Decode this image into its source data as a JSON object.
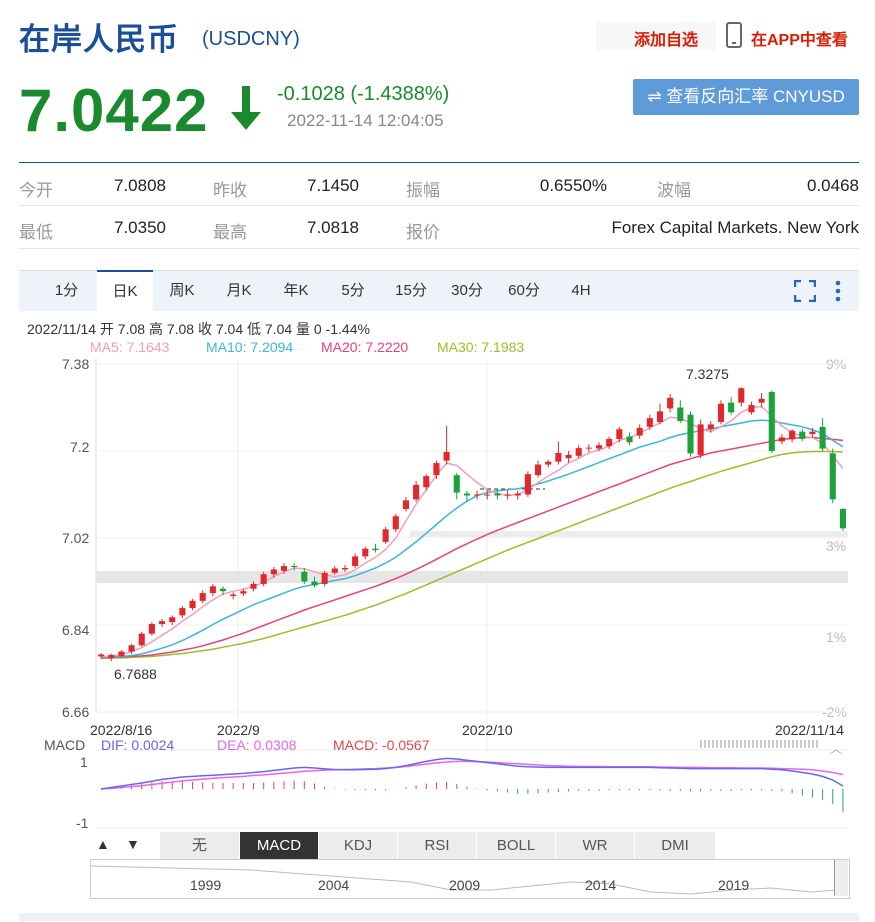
{
  "header": {
    "title": "在岸人民币",
    "code": "(USDCNY)",
    "add_watch": "添加自选",
    "view_app": "在APP中查看",
    "price": "7.0422",
    "change": "-0.1028 (-1.4388%)",
    "timestamp": "2022-11-14 12:04:05",
    "reverse_button": "⇌ 查看反向汇率 CNYUSD"
  },
  "stats": {
    "open_label": "今开",
    "open": "7.0808",
    "prev_close_label": "昨收",
    "prev_close": "7.1450",
    "amplitude_label": "振幅",
    "amplitude": "0.6550%",
    "wave_label": "波幅",
    "wave": "0.0468",
    "low_label": "最低",
    "low": "7.0350",
    "high_label": "最高",
    "high": "7.0818",
    "quote_label": "报价",
    "quote": "Forex Capital Markets. New York"
  },
  "period_tabs": [
    "1分",
    "日K",
    "周K",
    "月K",
    "年K",
    "5分",
    "15分",
    "30分",
    "60分",
    "4H"
  ],
  "active_period": "日K",
  "colors": {
    "up": "#e0292c",
    "down": "#1ca13b",
    "ma5": "#f0a0b8",
    "ma10": "#3cb5dc",
    "ma20": "#e8427a",
    "ma30": "#9bbf2a",
    "dif": "#6666ee",
    "dea": "#e666e6",
    "accent": "#1a4f95"
  },
  "chart_data": [
    {
      "type": "candlestick",
      "title": "",
      "info_line": "2022/11/14 开 7.08 高 7.08 收 7.04 低 7.04 量 0 -1.44%",
      "ma_legend": [
        {
          "name": "MA5",
          "text": "MA5: 7.1643"
        },
        {
          "name": "MA10",
          "text": "MA10: 7.2094"
        },
        {
          "name": "MA20",
          "text": "MA20: 7.2220"
        },
        {
          "name": "MA30",
          "text": "MA30: 7.1983"
        }
      ],
      "y_ticks": [
        "7.38",
        "7.2",
        "7.02",
        "6.84",
        "6.66"
      ],
      "y_tick_values": [
        7.38,
        7.2,
        7.02,
        6.84,
        6.66
      ],
      "right_ticks": [
        "9%",
        "3%",
        "1%",
        "-2%"
      ],
      "ylim": [
        6.66,
        7.38
      ],
      "x_ticks": [
        "2022/8/16",
        "2022/9",
        "2022/10",
        "2022/11/14"
      ],
      "max_label": "7.3275",
      "min_label": "6.7688",
      "candles": [
        [
          6.775,
          6.779,
          6.77,
          6.782
        ],
        [
          6.771,
          6.778,
          6.765,
          6.781
        ],
        [
          6.776,
          6.785,
          6.772,
          6.788
        ],
        [
          6.785,
          6.798,
          6.78,
          6.801
        ],
        [
          6.798,
          6.822,
          6.795,
          6.826
        ],
        [
          6.822,
          6.842,
          6.818,
          6.846
        ],
        [
          6.842,
          6.848,
          6.836,
          6.853
        ],
        [
          6.846,
          6.856,
          6.84,
          6.86
        ],
        [
          6.86,
          6.875,
          6.854,
          6.879
        ],
        [
          6.875,
          6.89,
          6.87,
          6.894
        ],
        [
          6.89,
          6.906,
          6.885,
          6.912
        ],
        [
          6.906,
          6.92,
          6.9,
          6.925
        ],
        [
          6.915,
          6.91,
          6.902,
          6.92
        ],
        [
          6.9,
          6.903,
          6.893,
          6.908
        ],
        [
          6.905,
          6.91,
          6.9,
          6.915
        ],
        [
          6.915,
          6.925,
          6.91,
          6.93
        ],
        [
          6.925,
          6.945,
          6.92,
          6.95
        ],
        [
          6.945,
          6.955,
          6.938,
          6.96
        ],
        [
          6.952,
          6.962,
          6.946,
          6.968
        ],
        [
          6.962,
          6.96,
          6.952,
          6.968
        ],
        [
          6.95,
          6.93,
          6.925,
          6.958
        ],
        [
          6.93,
          6.922,
          6.918,
          6.94
        ],
        [
          6.925,
          6.948,
          6.92,
          6.952
        ],
        [
          6.948,
          6.957,
          6.944,
          6.962
        ],
        [
          6.955,
          6.958,
          6.95,
          6.964
        ],
        [
          6.962,
          6.982,
          6.958,
          6.988
        ],
        [
          6.982,
          6.998,
          6.976,
          7.002
        ],
        [
          6.998,
          6.995,
          6.99,
          7.008
        ],
        [
          7.012,
          7.038,
          7.008,
          7.043
        ],
        [
          7.038,
          7.065,
          7.032,
          7.07
        ],
        [
          7.08,
          7.098,
          7.075,
          7.105
        ],
        [
          7.1,
          7.13,
          7.095,
          7.138
        ],
        [
          7.125,
          7.148,
          7.118,
          7.152
        ],
        [
          7.15,
          7.175,
          7.142,
          7.18
        ],
        [
          7.18,
          7.198,
          7.172,
          7.252
        ],
        [
          7.15,
          7.114,
          7.1,
          7.155
        ],
        [
          7.112,
          7.108,
          7.095,
          7.118
        ],
        [
          7.108,
          7.11,
          7.1,
          7.118
        ],
        [
          7.108,
          7.11,
          7.1,
          7.12
        ],
        [
          7.112,
          7.108,
          7.1,
          7.12
        ],
        [
          7.108,
          7.11,
          7.1,
          7.118
        ],
        [
          7.108,
          7.112,
          7.1,
          7.118
        ],
        [
          7.11,
          7.152,
          7.105,
          7.158
        ],
        [
          7.15,
          7.172,
          7.145,
          7.18
        ],
        [
          7.172,
          7.178,
          7.166,
          7.182
        ],
        [
          7.178,
          7.196,
          7.172,
          7.22
        ],
        [
          7.185,
          7.192,
          7.176,
          7.2
        ],
        [
          7.19,
          7.206,
          7.185,
          7.212
        ],
        [
          7.205,
          7.207,
          7.198,
          7.214
        ],
        [
          7.205,
          7.212,
          7.2,
          7.218
        ],
        [
          7.21,
          7.225,
          7.204,
          7.23
        ],
        [
          7.225,
          7.245,
          7.218,
          7.25
        ],
        [
          7.23,
          7.218,
          7.212,
          7.238
        ],
        [
          7.232,
          7.248,
          7.225,
          7.255
        ],
        [
          7.25,
          7.268,
          7.244,
          7.275
        ],
        [
          7.26,
          7.282,
          7.255,
          7.298
        ],
        [
          7.288,
          7.31,
          7.28,
          7.318
        ],
        [
          7.29,
          7.262,
          7.258,
          7.305
        ],
        [
          7.275,
          7.195,
          7.188,
          7.282
        ],
        [
          7.192,
          7.255,
          7.185,
          7.265
        ],
        [
          7.245,
          7.255,
          7.238,
          7.262
        ],
        [
          7.26,
          7.298,
          7.255,
          7.305
        ],
        [
          7.3,
          7.28,
          7.275,
          7.312
        ],
        [
          7.3,
          7.33,
          7.292,
          7.332
        ],
        [
          7.28,
          7.295,
          7.275,
          7.302
        ],
        [
          7.3,
          7.308,
          7.29,
          7.32
        ],
        [
          7.322,
          7.2,
          7.195,
          7.325
        ],
        [
          7.22,
          7.228,
          7.214,
          7.235
        ],
        [
          7.224,
          7.242,
          7.218,
          7.245
        ],
        [
          7.24,
          7.225,
          7.22,
          7.246
        ],
        [
          7.235,
          7.24,
          7.228,
          7.248
        ],
        [
          7.25,
          7.205,
          7.2,
          7.268
        ],
        [
          7.195,
          7.1,
          7.092,
          7.205
        ],
        [
          7.08,
          7.04,
          7.035,
          7.082
        ]
      ],
      "ma5": [
        6.774,
        6.776,
        6.779,
        6.785,
        6.793,
        6.805,
        6.819,
        6.832,
        6.848,
        6.862,
        6.878,
        6.892,
        6.904,
        6.91,
        6.914,
        6.92,
        6.928,
        6.94,
        6.95,
        6.958,
        6.956,
        6.95,
        6.944,
        6.94,
        6.944,
        6.954,
        6.968,
        6.98,
        6.996,
        7.02,
        7.055,
        7.09,
        7.12,
        7.15,
        7.175,
        7.17,
        7.152,
        7.135,
        7.12,
        7.112,
        7.108,
        7.11,
        7.12,
        7.135,
        7.148,
        7.16,
        7.175,
        7.185,
        7.196,
        7.202,
        7.21,
        7.222,
        7.228,
        7.236,
        7.248,
        7.258,
        7.27,
        7.268,
        7.258,
        7.245,
        7.24,
        7.25,
        7.262,
        7.28,
        7.29,
        7.292,
        7.272,
        7.252,
        7.238,
        7.23,
        7.228,
        7.216,
        7.19,
        7.164
      ],
      "ma10": [
        6.773,
        6.774,
        6.775,
        6.777,
        6.78,
        6.786,
        6.792,
        6.799,
        6.808,
        6.818,
        6.829,
        6.841,
        6.852,
        6.862,
        6.872,
        6.882,
        6.89,
        6.898,
        6.906,
        6.914,
        6.92,
        6.924,
        6.928,
        6.932,
        6.936,
        6.942,
        6.95,
        6.958,
        6.968,
        6.98,
        6.996,
        7.012,
        7.03,
        7.048,
        7.066,
        7.082,
        7.096,
        7.108,
        7.114,
        7.118,
        7.12,
        7.122,
        7.126,
        7.132,
        7.138,
        7.145,
        7.152,
        7.16,
        7.168,
        7.176,
        7.184,
        7.192,
        7.2,
        7.208,
        7.214,
        7.22,
        7.228,
        7.234,
        7.238,
        7.242,
        7.246,
        7.25,
        7.254,
        7.258,
        7.262,
        7.264,
        7.262,
        7.258,
        7.254,
        7.25,
        7.244,
        7.236,
        7.222,
        7.209
      ],
      "ma20": [
        6.772,
        6.773,
        6.774,
        6.775,
        6.776,
        6.778,
        6.781,
        6.784,
        6.788,
        6.792,
        6.797,
        6.803,
        6.809,
        6.816,
        6.823,
        6.831,
        6.839,
        6.847,
        6.855,
        6.863,
        6.871,
        6.878,
        6.885,
        6.892,
        6.899,
        6.906,
        6.913,
        6.92,
        6.928,
        6.936,
        6.945,
        6.955,
        6.965,
        6.976,
        6.987,
        6.998,
        7.008,
        7.018,
        7.027,
        7.036,
        7.044,
        7.052,
        7.06,
        7.068,
        7.076,
        7.084,
        7.092,
        7.1,
        7.108,
        7.116,
        7.124,
        7.132,
        7.14,
        7.148,
        7.156,
        7.164,
        7.172,
        7.178,
        7.184,
        7.19,
        7.196,
        7.2,
        7.204,
        7.208,
        7.212,
        7.216,
        7.22,
        7.224,
        7.226,
        7.228,
        7.228,
        7.226,
        7.224,
        7.222
      ],
      "ma30": [
        6.771,
        6.772,
        6.772,
        6.773,
        6.774,
        6.775,
        6.777,
        6.779,
        6.781,
        6.784,
        6.787,
        6.79,
        6.794,
        6.798,
        6.802,
        6.807,
        6.812,
        6.818,
        6.824,
        6.83,
        6.836,
        6.842,
        6.848,
        6.854,
        6.86,
        6.867,
        6.874,
        6.881,
        6.889,
        6.897,
        6.905,
        6.914,
        6.923,
        6.932,
        6.941,
        6.95,
        6.959,
        6.968,
        6.977,
        6.986,
        6.995,
        7.003,
        7.011,
        7.019,
        7.027,
        7.035,
        7.043,
        7.051,
        7.059,
        7.067,
        7.075,
        7.083,
        7.091,
        7.099,
        7.107,
        7.115,
        7.123,
        7.13,
        7.137,
        7.144,
        7.151,
        7.158,
        7.164,
        7.17,
        7.176,
        7.182,
        7.188,
        7.193,
        7.196,
        7.198,
        7.199,
        7.199,
        7.199,
        7.198
      ]
    },
    {
      "type": "macd",
      "legend_title": "MACD",
      "legend": [
        {
          "name": "DIF",
          "text": "DIF: 0.0024"
        },
        {
          "name": "DEA",
          "text": "DEA: 0.0308"
        },
        {
          "name": "MACD",
          "text": "MACD: -0.0567"
        }
      ],
      "y_ticks": [
        "1",
        "-1"
      ],
      "dif": [
        0.0,
        0.05,
        0.1,
        0.15,
        0.2,
        0.26,
        0.32,
        0.36,
        0.4,
        0.42,
        0.44,
        0.46,
        0.48,
        0.5,
        0.52,
        0.55,
        0.58,
        0.62,
        0.66,
        0.7,
        0.72,
        0.7,
        0.67,
        0.65,
        0.64,
        0.64,
        0.65,
        0.66,
        0.68,
        0.72,
        0.78,
        0.85,
        0.92,
        0.98,
        1.02,
        1.0,
        0.96,
        0.92,
        0.88,
        0.84,
        0.8,
        0.76,
        0.74,
        0.73,
        0.72,
        0.72,
        0.72,
        0.72,
        0.72,
        0.72,
        0.72,
        0.72,
        0.72,
        0.72,
        0.72,
        0.71,
        0.7,
        0.69,
        0.68,
        0.68,
        0.68,
        0.68,
        0.68,
        0.68,
        0.68,
        0.68,
        0.66,
        0.64,
        0.6,
        0.55,
        0.5,
        0.42,
        0.3,
        0.1
      ],
      "dea": [
        0.0,
        0.02,
        0.05,
        0.08,
        0.11,
        0.15,
        0.19,
        0.23,
        0.27,
        0.3,
        0.33,
        0.36,
        0.38,
        0.4,
        0.42,
        0.45,
        0.47,
        0.5,
        0.53,
        0.56,
        0.59,
        0.61,
        0.63,
        0.64,
        0.65,
        0.66,
        0.67,
        0.68,
        0.7,
        0.72,
        0.75,
        0.79,
        0.83,
        0.87,
        0.9,
        0.92,
        0.92,
        0.91,
        0.9,
        0.88,
        0.86,
        0.84,
        0.82,
        0.8,
        0.78,
        0.77,
        0.76,
        0.75,
        0.75,
        0.75,
        0.74,
        0.74,
        0.74,
        0.74,
        0.74,
        0.73,
        0.73,
        0.72,
        0.72,
        0.72,
        0.71,
        0.71,
        0.71,
        0.7,
        0.7,
        0.7,
        0.69,
        0.68,
        0.67,
        0.66,
        0.64,
        0.6,
        0.55,
        0.48
      ],
      "hist": [
        0.0,
        0.06,
        0.1,
        0.14,
        0.18,
        0.22,
        0.26,
        0.26,
        0.26,
        0.24,
        0.22,
        0.2,
        0.2,
        0.2,
        0.2,
        0.2,
        0.22,
        0.24,
        0.26,
        0.28,
        0.26,
        0.18,
        0.08,
        0.02,
        -0.02,
        -0.04,
        -0.04,
        -0.04,
        -0.04,
        0.0,
        0.06,
        0.12,
        0.18,
        0.22,
        0.24,
        0.16,
        0.08,
        0.02,
        -0.04,
        -0.08,
        -0.12,
        -0.16,
        -0.16,
        -0.14,
        -0.12,
        -0.1,
        -0.08,
        -0.06,
        -0.06,
        -0.06,
        -0.04,
        -0.04,
        -0.04,
        -0.04,
        -0.04,
        -0.04,
        -0.06,
        -0.06,
        -0.08,
        -0.08,
        -0.06,
        -0.06,
        -0.06,
        -0.04,
        -0.04,
        -0.04,
        -0.06,
        -0.08,
        -0.14,
        -0.22,
        -0.28,
        -0.36,
        -0.5,
        -0.76
      ]
    }
  ],
  "indicator_tabs": [
    "无",
    "MACD",
    "KDJ",
    "RSI",
    "BOLL",
    "WR",
    "DMI"
  ],
  "active_indicator": "MACD",
  "nav_arrows": {
    "up": "▲",
    "down": "▼"
  },
  "navigator_years": [
    "1999",
    "2004",
    "2009",
    "2014",
    "2019"
  ]
}
